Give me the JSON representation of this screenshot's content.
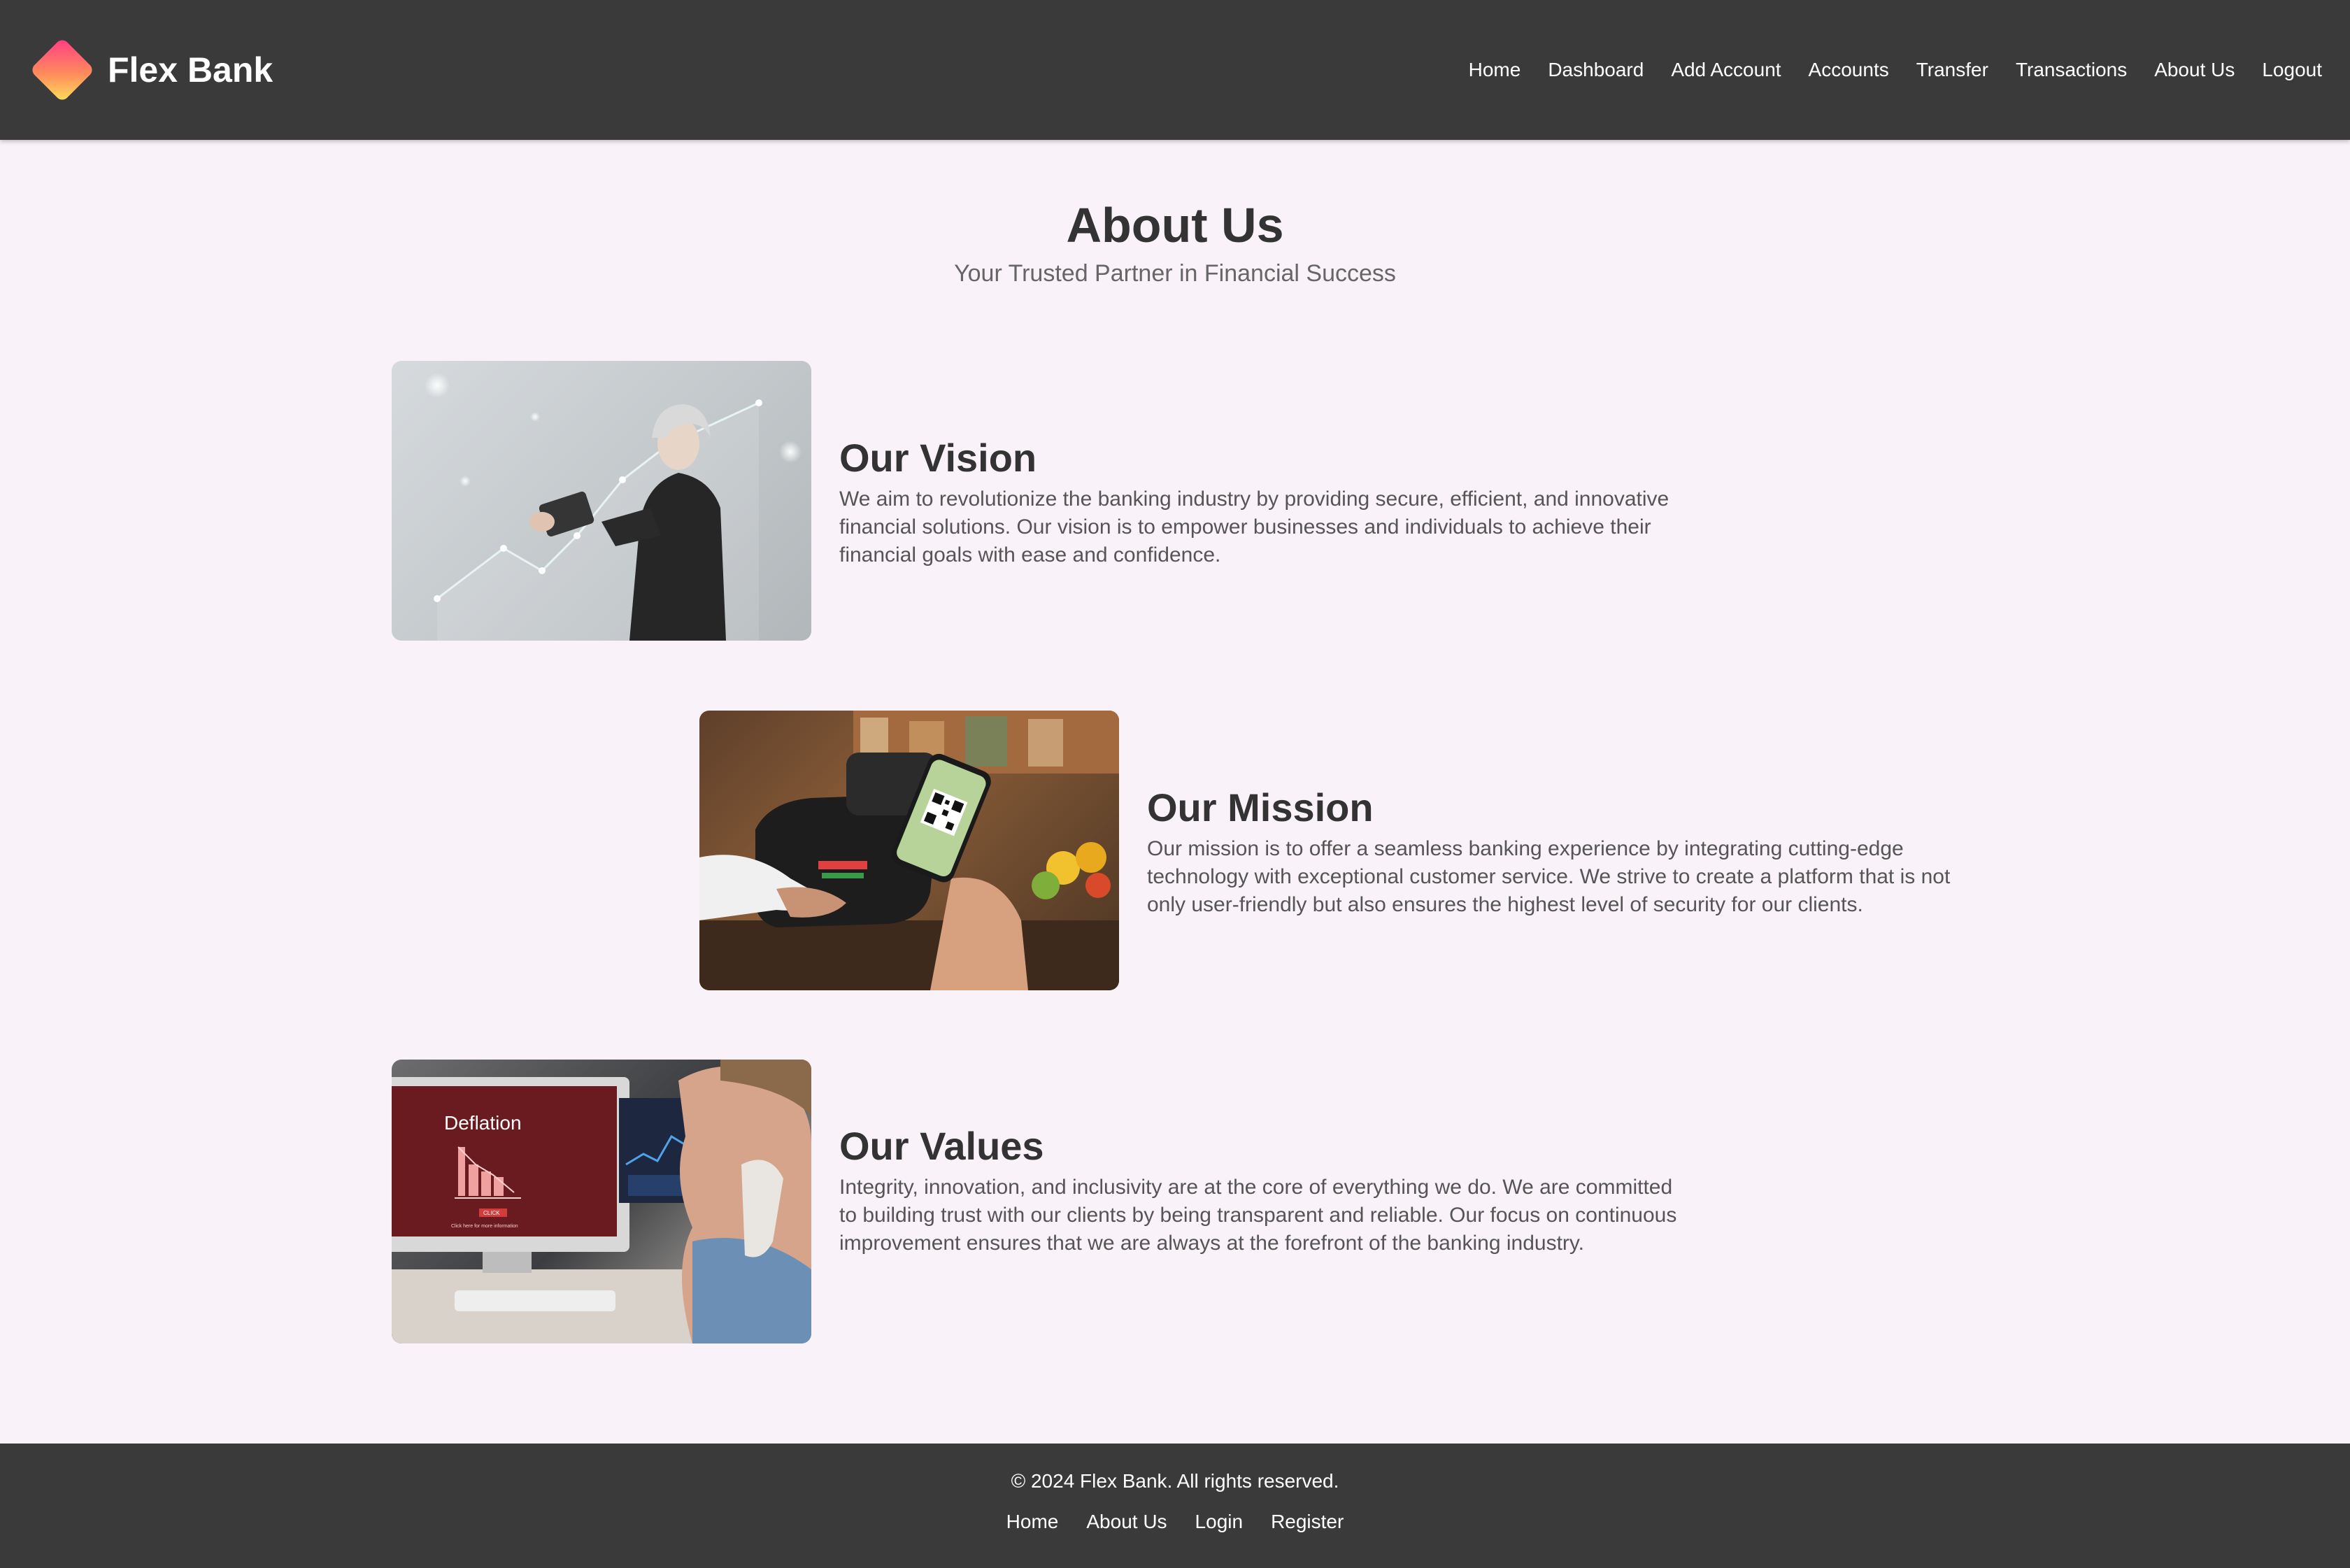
{
  "header": {
    "brand_name": "Flex Bank",
    "nav": [
      {
        "label": "Home"
      },
      {
        "label": "Dashboard"
      },
      {
        "label": "Add Account"
      },
      {
        "label": "Accounts"
      },
      {
        "label": "Transfer"
      },
      {
        "label": "Transactions"
      },
      {
        "label": "About Us"
      },
      {
        "label": "Logout"
      }
    ]
  },
  "hero": {
    "title": "About Us",
    "subtitle": "Your Trusted Partner in Financial Success"
  },
  "sections": [
    {
      "heading": "Our Vision",
      "body": "We aim to revolutionize the banking industry by providing secure, efficient, and innovative financial solutions. Our vision is to empower businesses and individuals to achieve their financial goals with ease and confidence."
    },
    {
      "heading": "Our Mission",
      "body": "Our mission is to offer a seamless banking experience by integrating cutting-edge technology with exceptional customer service. We strive to create a platform that is not only user-friendly but also ensures the highest level of security for our clients."
    },
    {
      "heading": "Our Values",
      "body": "Integrity, innovation, and inclusivity are at the core of everything we do. We are committed to building trust with our clients by being transparent and reliable. Our focus on continuous improvement ensures that we are always at the forefront of the banking industry.",
      "image_text": {
        "screen_title": "Deflation",
        "button": "CLICK",
        "caption": "Click here for more information"
      }
    }
  ],
  "footer": {
    "copyright": "© 2024 Flex Bank. All rights reserved.",
    "links": [
      {
        "label": "Home"
      },
      {
        "label": "About Us"
      },
      {
        "label": "Login"
      },
      {
        "label": "Register"
      }
    ]
  },
  "colors": {
    "header_bg": "#3a3a3a",
    "page_bg": "#f9f2f8",
    "text_dark": "#333333",
    "text_muted": "#555555",
    "logo_gradient": [
      "#ff3b86",
      "#ff8a5c",
      "#ffe25a"
    ]
  },
  "icons": {
    "logo": "diamond-logo-icon"
  }
}
